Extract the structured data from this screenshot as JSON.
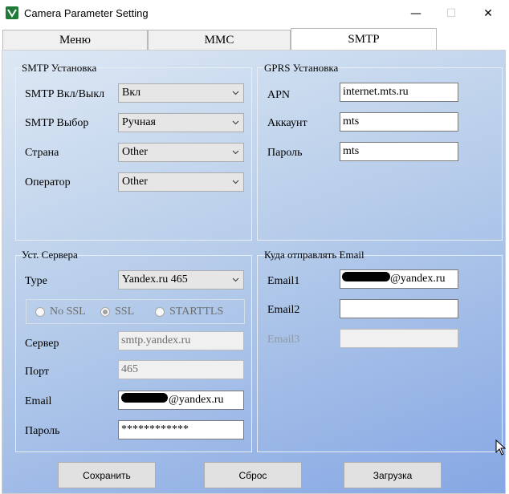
{
  "window": {
    "title": "Camera Parameter Setting",
    "minimize": "—",
    "maximize": "☐",
    "close": "✕"
  },
  "tabs": [
    {
      "label": "Меню"
    },
    {
      "label": "MMC"
    },
    {
      "label": "SMTP"
    }
  ],
  "smtp_group": {
    "title": "SMTP Установка",
    "enable_label": "SMTP Вкл/Выкл",
    "enable_value": "Вкл",
    "choice_label": "SMTP Выбор",
    "choice_value": "Ручная",
    "country_label": "Страна",
    "country_value": "Other",
    "operator_label": "Оператор",
    "operator_value": "Other"
  },
  "gprs_group": {
    "title": "GPRS Установка",
    "apn_label": "APN",
    "apn_value": "internet.mts.ru",
    "account_label": "Аккаунт",
    "account_value": "mts",
    "password_label": "Пароль",
    "password_value": "mts"
  },
  "server_group": {
    "title": "Уст. Сервера",
    "type_label": "Type",
    "type_value": "Yandex.ru 465",
    "ssl_options": [
      "No SSL",
      "SSL",
      "STARTTLS"
    ],
    "server_label": "Сервер",
    "server_value": "smtp.yandex.ru",
    "port_label": "Порт",
    "port_value": "465",
    "email_label": "Email",
    "email_value": "@yandex.ru",
    "password_label": "Пароль",
    "password_value": "************"
  },
  "send_group": {
    "title": "Куда отправлять Email",
    "email1_label": "Email1",
    "email1_value": "@yandex.ru",
    "email2_label": "Email2",
    "email2_value": "",
    "email3_label": "Email3",
    "email3_value": ""
  },
  "buttons": {
    "save": "Сохранить",
    "reset": "Сброс",
    "load": "Загрузка"
  }
}
